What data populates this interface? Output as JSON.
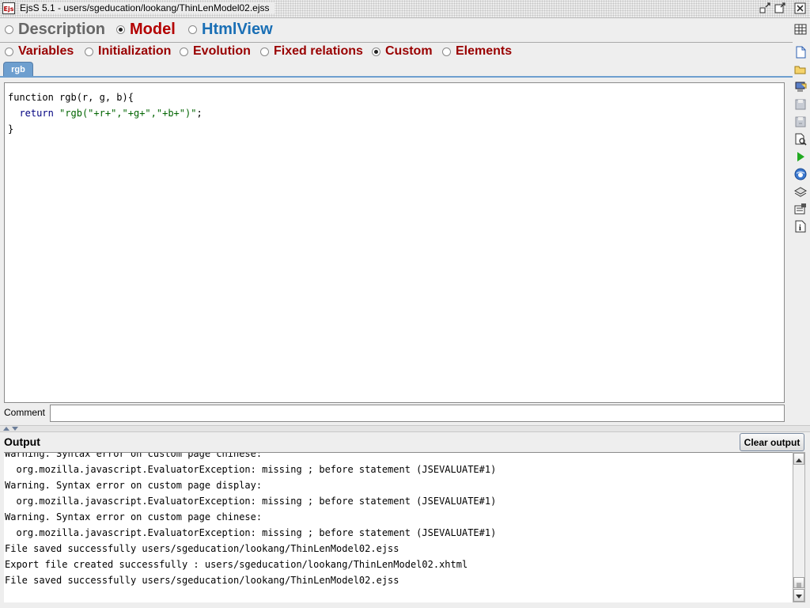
{
  "window": {
    "app_icon_text": "Ejs",
    "title": "EjsS 5.1 - users/sgeducation/lookang/ThinLenModel02.ejss"
  },
  "main_tabs": [
    {
      "label": "Description",
      "selected": false,
      "color": "#666666"
    },
    {
      "label": "Model",
      "selected": true,
      "color": "#b30000"
    },
    {
      "label": "HtmlView",
      "selected": false,
      "color": "#1a6fb5"
    }
  ],
  "model_tabs": [
    {
      "label": "Variables",
      "selected": false
    },
    {
      "label": "Initialization",
      "selected": false
    },
    {
      "label": "Evolution",
      "selected": false
    },
    {
      "label": "Fixed relations",
      "selected": false
    },
    {
      "label": "Custom",
      "selected": true
    },
    {
      "label": "Elements",
      "selected": false
    }
  ],
  "page_tab": {
    "label": "rgb"
  },
  "editor": {
    "line1": "function rgb(r, g, b){",
    "line2_kw": "return",
    "line2_str": "\"rgb(\"+r+\",\"+g+\",\"+b+\")\"",
    "line2_end": ";",
    "line3": "}"
  },
  "comment": {
    "label": "Comment",
    "value": ""
  },
  "output": {
    "label": "Output",
    "clear_label": "Clear output",
    "lines": [
      "Warning. Syntax error on custom page chinese:",
      "  org.mozilla.javascript.EvaluatorException: missing ; before statement (JSEVALUATE#1)",
      "Warning. Syntax error on custom page display:",
      "  org.mozilla.javascript.EvaluatorException: missing ; before statement (JSEVALUATE#1)",
      "Warning. Syntax error on custom page chinese:",
      "  org.mozilla.javascript.EvaluatorException: missing ; before statement (JSEVALUATE#1)",
      "File saved successfully users/sgeducation/lookang/ThinLenModel02.ejss",
      "Export file created successfully : users/sgeducation/lookang/ThinLenModel02.xhtml",
      "File saved successfully users/sgeducation/lookang/ThinLenModel02.ejss"
    ]
  },
  "toolbar": [
    "new-file-icon",
    "open-folder-icon",
    "open-workspace-icon",
    "save-icon",
    "save-as-icon",
    "search-icon",
    "run-icon",
    "web-icon",
    "library-icon",
    "preferences-icon",
    "info-icon"
  ]
}
